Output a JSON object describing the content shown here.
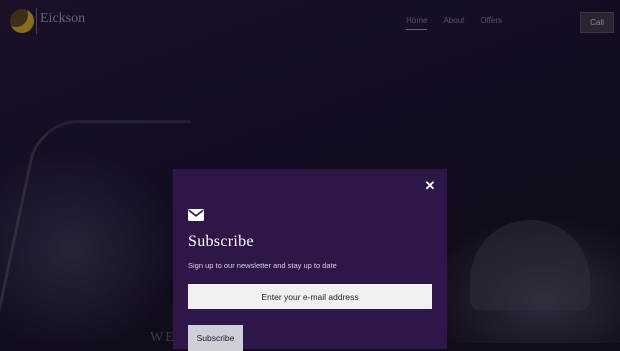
{
  "header": {
    "brand": "Eickson",
    "nav": [
      "Home",
      "About",
      "Offers"
    ],
    "call_label": "Call"
  },
  "hero": {
    "headline": "",
    "bottom_text": "WE · · · LP"
  },
  "modal": {
    "close_icon": "close-icon",
    "mail_icon": "envelope-icon",
    "title": "Subscribe",
    "subtitle": "Sign up to our newsletter and stay up to date",
    "email_placeholder": "Enter your e-mail address",
    "subscribe_label": "Subscribe",
    "colors": {
      "background": "#2e1748",
      "button": "#cdd0d6",
      "input": "#f0f0f0"
    }
  }
}
